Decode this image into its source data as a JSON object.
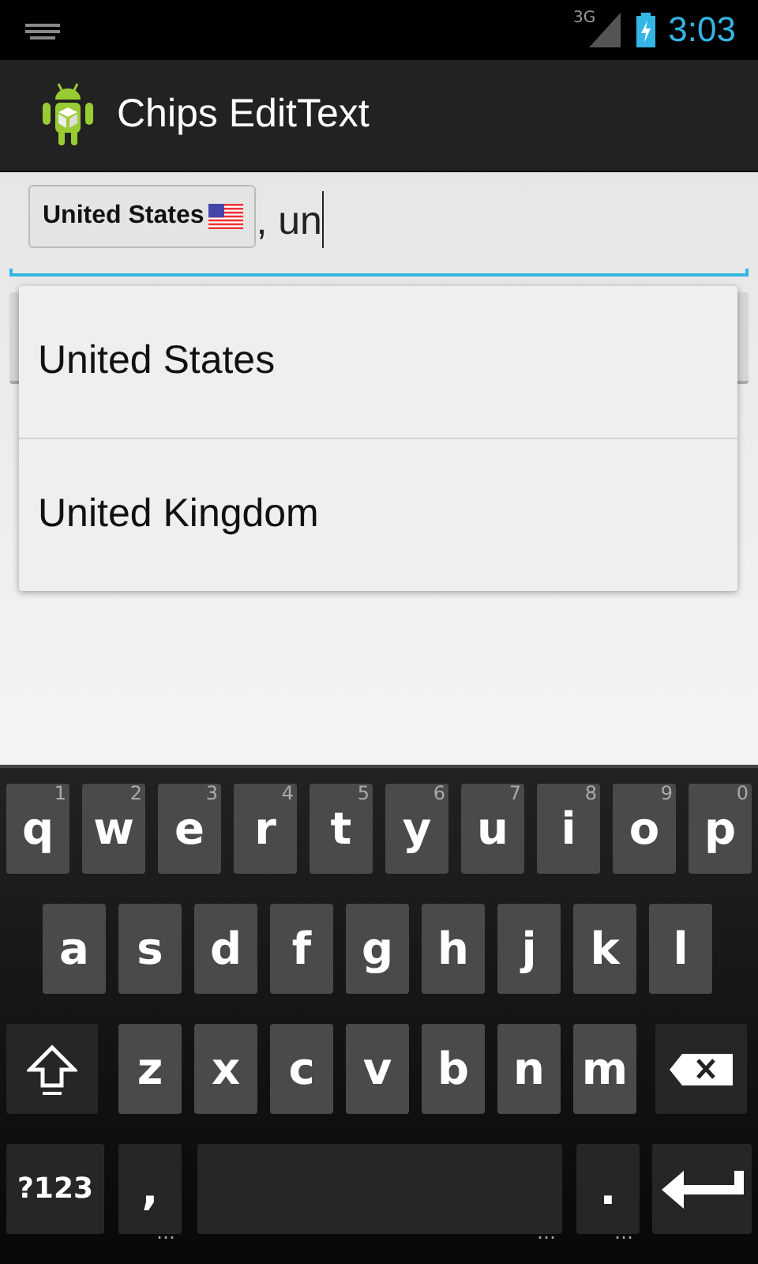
{
  "status_bar": {
    "network": "3G",
    "time": "3:03"
  },
  "app_bar": {
    "title": "Chips EditText"
  },
  "field": {
    "chips": [
      {
        "label": "United States"
      }
    ],
    "text": ", un"
  },
  "suggestions": [
    {
      "label": "United States"
    },
    {
      "label": "United Kingdom"
    }
  ],
  "keyboard": {
    "rows": [
      {
        "keys": [
          {
            "kind": "letter",
            "label": "q",
            "hint": "1"
          },
          {
            "kind": "letter",
            "label": "w",
            "hint": "2"
          },
          {
            "kind": "letter",
            "label": "e",
            "hint": "3"
          },
          {
            "kind": "letter",
            "label": "r",
            "hint": "4"
          },
          {
            "kind": "letter",
            "label": "t",
            "hint": "5"
          },
          {
            "kind": "letter",
            "label": "y",
            "hint": "6"
          },
          {
            "kind": "letter",
            "label": "u",
            "hint": "7"
          },
          {
            "kind": "letter",
            "label": "i",
            "hint": "8"
          },
          {
            "kind": "letter",
            "label": "o",
            "hint": "9"
          },
          {
            "kind": "letter",
            "label": "p",
            "hint": "0"
          }
        ]
      },
      {
        "keys": [
          {
            "kind": "letter",
            "label": "a"
          },
          {
            "kind": "letter",
            "label": "s"
          },
          {
            "kind": "letter",
            "label": "d"
          },
          {
            "kind": "letter",
            "label": "f"
          },
          {
            "kind": "letter",
            "label": "g"
          },
          {
            "kind": "letter",
            "label": "h"
          },
          {
            "kind": "letter",
            "label": "j"
          },
          {
            "kind": "letter",
            "label": "k"
          },
          {
            "kind": "letter",
            "label": "l"
          }
        ]
      },
      {
        "keys": [
          {
            "kind": "shift"
          },
          {
            "kind": "letter",
            "label": "z"
          },
          {
            "kind": "letter",
            "label": "x"
          },
          {
            "kind": "letter",
            "label": "c"
          },
          {
            "kind": "letter",
            "label": "v"
          },
          {
            "kind": "letter",
            "label": "b"
          },
          {
            "kind": "letter",
            "label": "n"
          },
          {
            "kind": "letter",
            "label": "m"
          },
          {
            "kind": "delete"
          }
        ]
      },
      {
        "keys": [
          {
            "kind": "symbols",
            "label": "?123"
          },
          {
            "kind": "punct",
            "label": ",",
            "hint": "…"
          },
          {
            "kind": "space",
            "hint": "…"
          },
          {
            "kind": "punct",
            "label": ".",
            "hint": "…"
          },
          {
            "kind": "enter"
          }
        ]
      }
    ]
  }
}
